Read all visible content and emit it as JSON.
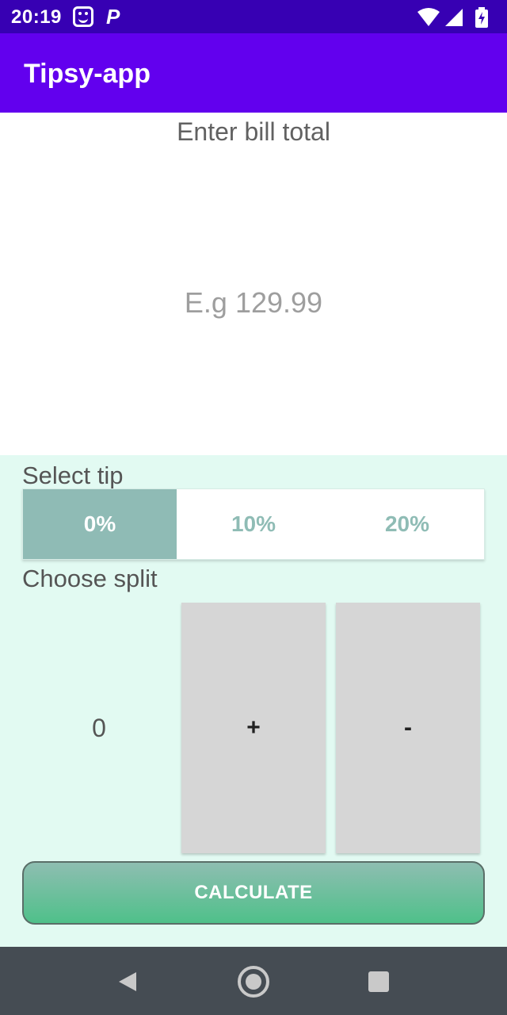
{
  "status_bar": {
    "time": "20:19",
    "notification_icons": [
      "smiley-icon",
      "p-icon"
    ],
    "system_icons": [
      "wifi-icon",
      "signal-icon",
      "battery-charging-icon"
    ],
    "p_glyph": "P"
  },
  "app_bar": {
    "title": "Tipsy-app",
    "color": "#6200ee"
  },
  "bill": {
    "label": "Enter bill total",
    "placeholder": "E.g 129.99",
    "value": ""
  },
  "tip": {
    "label": "Select tip",
    "options": [
      "0%",
      "10%",
      "20%"
    ],
    "selected": "0%"
  },
  "split": {
    "label": "Choose split",
    "value": "0",
    "plus_label": "+",
    "minus_label": "-"
  },
  "calculate": {
    "label": "CALCULATE"
  },
  "nav_bar": {
    "buttons": [
      "back-icon",
      "home-icon",
      "recents-icon"
    ]
  },
  "colors": {
    "status_bar": "#3700b3",
    "app_bar": "#6200ee",
    "lower_background": "#e2faf2",
    "tip_selected": "#8fbbb5",
    "calc_gradient_top": "#8ebeb1",
    "calc_gradient_bottom": "#4fc08a"
  }
}
